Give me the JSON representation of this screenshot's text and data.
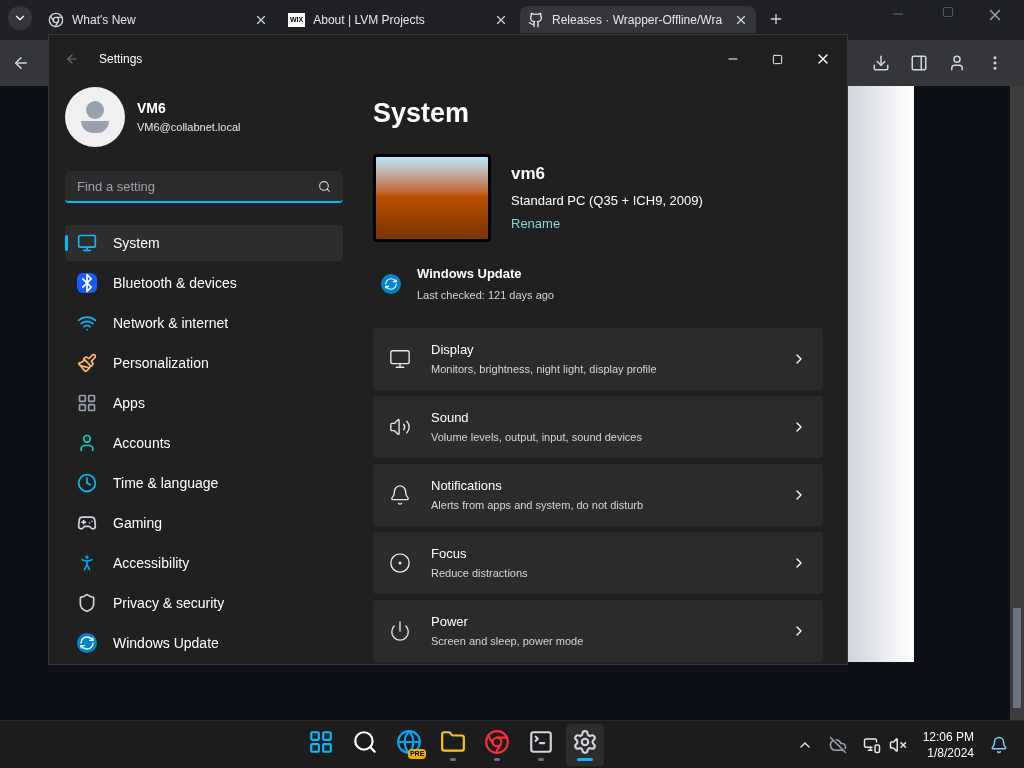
{
  "browser": {
    "tabs": [
      {
        "title": "What's New",
        "kind": "chrome",
        "selected": false
      },
      {
        "title": "About | LVM Projects",
        "kind": "wix",
        "favicon_text": "WIX",
        "selected": false
      },
      {
        "title": "Releases · Wrapper-Offline/Wra",
        "kind": "github",
        "selected": true
      }
    ]
  },
  "settings": {
    "title": "Settings",
    "user": {
      "name": "VM6",
      "email": "VM6@collabnet.local"
    },
    "search": {
      "placeholder": "Find a setting"
    },
    "nav": [
      {
        "label": "System",
        "kind": "system",
        "selected": true
      },
      {
        "label": "Bluetooth & devices",
        "kind": "bluetooth",
        "selected": false
      },
      {
        "label": "Network & internet",
        "kind": "network",
        "selected": false
      },
      {
        "label": "Personalization",
        "kind": "personalization",
        "selected": false
      },
      {
        "label": "Apps",
        "kind": "apps",
        "selected": false
      },
      {
        "label": "Accounts",
        "kind": "accounts",
        "selected": false
      },
      {
        "label": "Time & language",
        "kind": "time",
        "selected": false
      },
      {
        "label": "Gaming",
        "kind": "gaming",
        "selected": false
      },
      {
        "label": "Accessibility",
        "kind": "accessibility",
        "selected": false
      },
      {
        "label": "Privacy & security",
        "kind": "privacy",
        "selected": false
      },
      {
        "label": "Windows Update",
        "kind": "update",
        "selected": false
      }
    ],
    "page_title": "System",
    "device": {
      "name": "vm6",
      "model": "Standard PC (Q35 + ICH9, 2009)",
      "rename": "Rename"
    },
    "update": {
      "title": "Windows Update",
      "subtitle": "Last checked: 121 days ago"
    },
    "cards": [
      {
        "kind": "display",
        "title": "Display",
        "subtitle": "Monitors, brightness, night light, display profile"
      },
      {
        "kind": "sound",
        "title": "Sound",
        "subtitle": "Volume levels, output, input, sound devices"
      },
      {
        "kind": "notifications",
        "title": "Notifications",
        "subtitle": "Alerts from apps and system, do not disturb"
      },
      {
        "kind": "focus",
        "title": "Focus",
        "subtitle": "Reduce distractions"
      },
      {
        "kind": "power",
        "title": "Power",
        "subtitle": "Screen and sleep, power mode"
      }
    ]
  },
  "taskbar": {
    "apps": [
      {
        "kind": "start",
        "running": false,
        "selected": false
      },
      {
        "kind": "search",
        "running": false,
        "selected": false
      },
      {
        "kind": "edge",
        "badge": "PRE",
        "running": false,
        "selected": false
      },
      {
        "kind": "explorer",
        "running": true,
        "selected": false
      },
      {
        "kind": "chrome",
        "running": true,
        "selected": false
      },
      {
        "kind": "terminal",
        "running": true,
        "selected": false
      },
      {
        "kind": "settings",
        "running": true,
        "selected": true
      }
    ],
    "time": "12:06 PM",
    "date": "1/8/2024"
  }
}
